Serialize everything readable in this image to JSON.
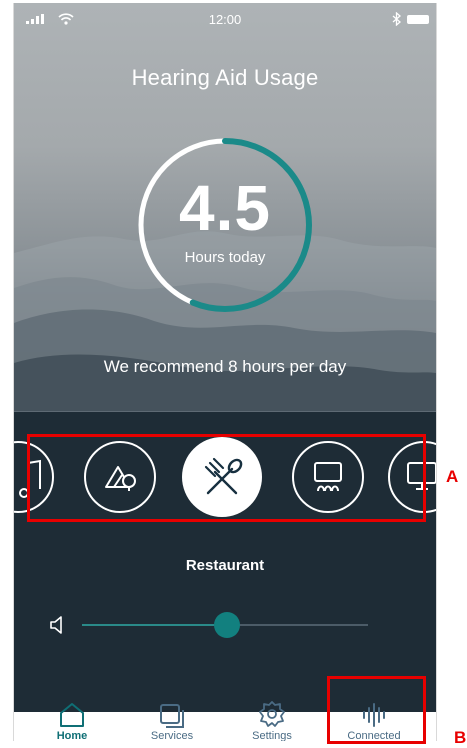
{
  "status_bar": {
    "time": "12:00"
  },
  "header": {
    "title": "Hearing Aid Usage"
  },
  "usage": {
    "value": "4.5",
    "unit": "Hours today",
    "progress_fraction": 0.5625,
    "recommendation": "We recommend 8 hours per day"
  },
  "programs": {
    "items": [
      {
        "icon": "music-icon"
      },
      {
        "icon": "outdoor-icon"
      },
      {
        "icon": "restaurant-icon",
        "selected": true
      },
      {
        "icon": "theater-icon"
      },
      {
        "icon": "tv-icon"
      }
    ],
    "selected_label": "Restaurant"
  },
  "volume": {
    "level_fraction": 0.47
  },
  "tabbar": {
    "tabs": [
      {
        "label": "Home",
        "icon": "home-icon",
        "active": true
      },
      {
        "label": "Services",
        "icon": "services-icon"
      },
      {
        "label": "Settings",
        "icon": "settings-icon"
      },
      {
        "label": "Connected",
        "icon": "connected-icon"
      }
    ]
  },
  "annotations": {
    "programs_callout": "A",
    "connected_callout": "B"
  },
  "colors": {
    "accent": "#1b8a89",
    "dark_panel": "#1e2c36",
    "annotation_red": "#e80000"
  }
}
